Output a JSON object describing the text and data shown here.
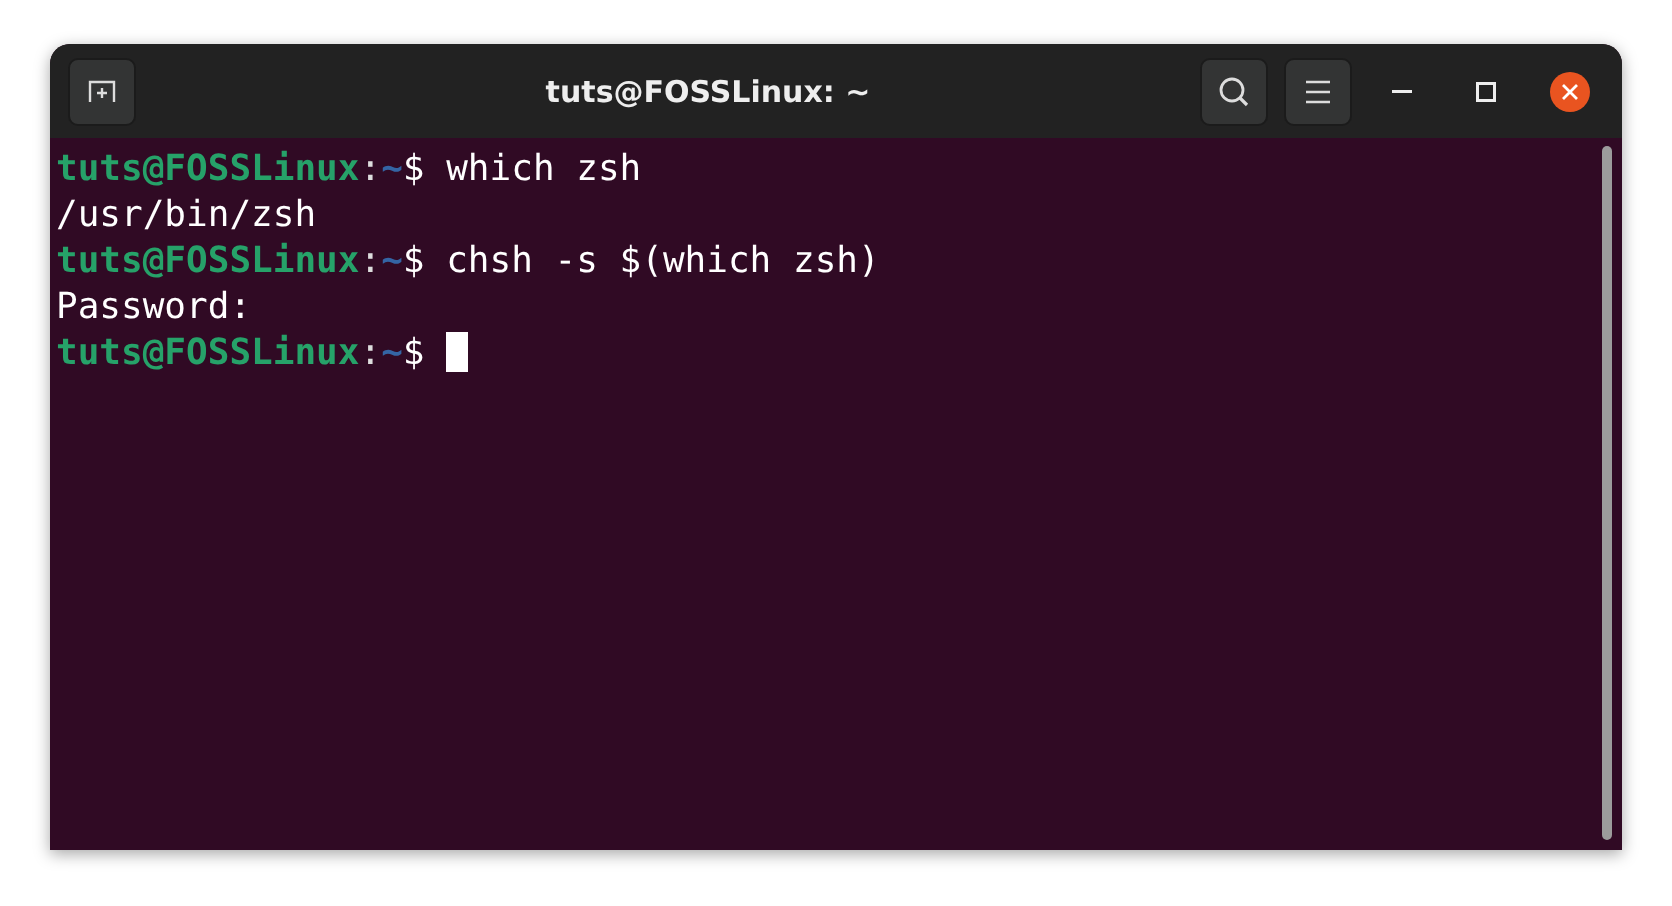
{
  "window": {
    "title": "tuts@FOSSLinux: ~"
  },
  "lines": [
    {
      "kind": "prompt",
      "user_host": "tuts@FOSSLinux",
      "separator": ":",
      "path": "~",
      "symbol": "$",
      "command": "which zsh"
    },
    {
      "kind": "output",
      "text": "/usr/bin/zsh"
    },
    {
      "kind": "prompt",
      "user_host": "tuts@FOSSLinux",
      "separator": ":",
      "path": "~",
      "symbol": "$",
      "command": "chsh -s $(which zsh)"
    },
    {
      "kind": "output",
      "text": "Password:"
    },
    {
      "kind": "prompt",
      "user_host": "tuts@FOSSLinux",
      "separator": ":",
      "path": "~",
      "symbol": "$",
      "cursor": true
    }
  ]
}
